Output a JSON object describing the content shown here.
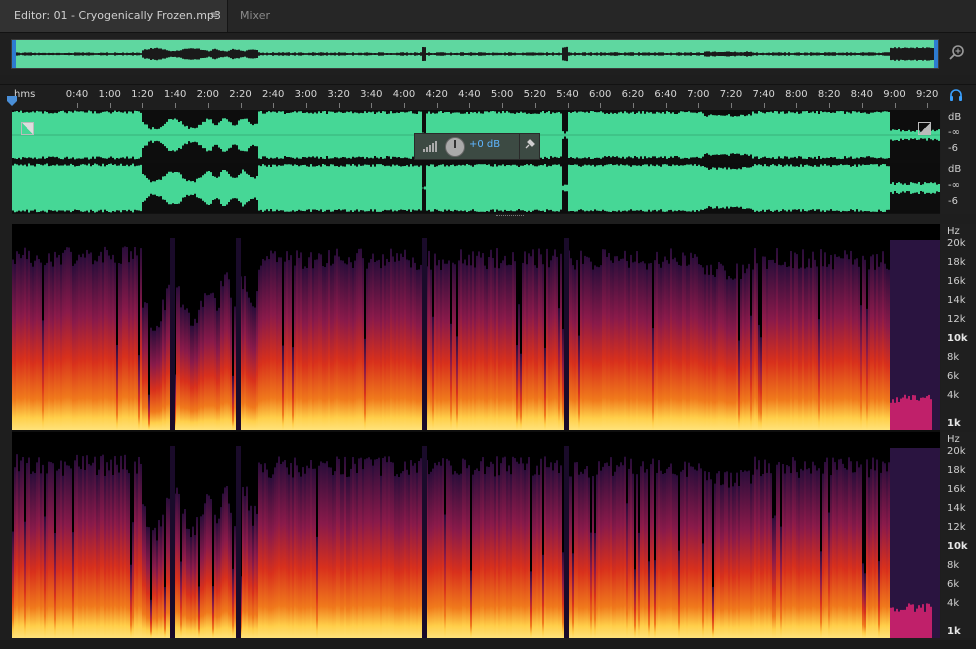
{
  "tabs": {
    "editor_label": "Editor: 01 - Cryogenically Frozen.mp3",
    "menu_icon": "≡",
    "mixer_label": "Mixer"
  },
  "ruler": {
    "unit": "hms",
    "ticks": [
      "0:40",
      "1:00",
      "1:20",
      "1:40",
      "2:00",
      "2:20",
      "2:40",
      "3:00",
      "3:20",
      "3:40",
      "4:00",
      "4:20",
      "4:40",
      "5:00",
      "5:20",
      "5:40",
      "6:00",
      "6:20",
      "6:40",
      "7:00",
      "7:20",
      "7:40",
      "8:00",
      "8:20",
      "8:40",
      "9:00",
      "9:20"
    ]
  },
  "waveform": {
    "db_labels": [
      "dB",
      "-∞",
      "-6",
      "dB",
      "-∞",
      "-6"
    ]
  },
  "hud": {
    "value": "+0 dB"
  },
  "spectral": {
    "hz_labels": [
      "Hz",
      "20k",
      "18k",
      "16k",
      "14k",
      "12k",
      "10k",
      "8k",
      "6k",
      "4k",
      "1k"
    ]
  },
  "icons": {
    "zoom": "zoom-icon",
    "headphones": "headphones-icon",
    "pin": "pin-icon",
    "knob": "volume-knob-icon"
  },
  "colors": {
    "waveform": "#46d796",
    "overview": "#5fd7a0",
    "accent": "#2d7bd0",
    "spectral_hot": "#ffd24a",
    "spectral_mid": "#e8401a",
    "spectral_cool": "#4a1a6a"
  }
}
